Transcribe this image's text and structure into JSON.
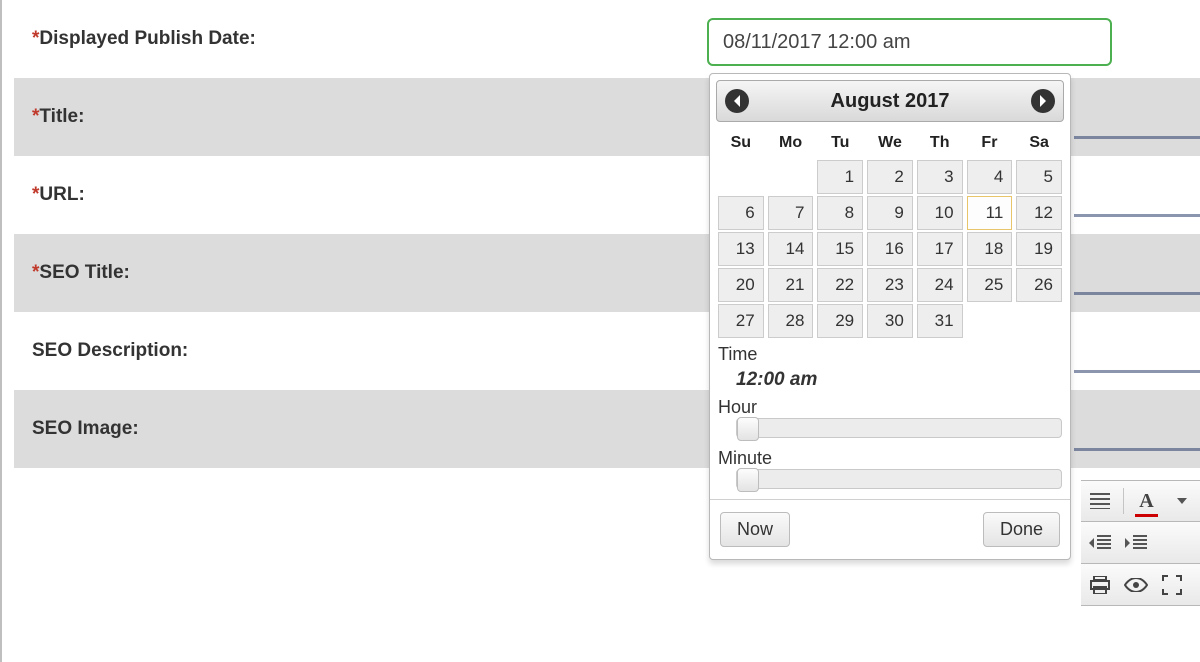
{
  "form": {
    "displayed_publish_date_label": "Displayed Publish Date:",
    "title_label": "Title:",
    "url_label": "URL:",
    "seo_title_label": "SEO Title:",
    "seo_description_label": "SEO Description:",
    "seo_image_label": "SEO Image:",
    "publish_date_value": "08/11/2017 12:00 am"
  },
  "datepicker": {
    "title": "August 2017",
    "day_headers": [
      "Su",
      "Mo",
      "Tu",
      "We",
      "Th",
      "Fr",
      "Sa"
    ],
    "selected_day": 11,
    "weeks": [
      [
        null,
        null,
        1,
        2,
        3,
        4,
        5
      ],
      [
        6,
        7,
        8,
        9,
        10,
        11,
        12
      ],
      [
        13,
        14,
        15,
        16,
        17,
        18,
        19
      ],
      [
        20,
        21,
        22,
        23,
        24,
        25,
        26
      ],
      [
        27,
        28,
        29,
        30,
        31,
        null,
        null
      ]
    ],
    "time_label": "Time",
    "time_value": "12:00 am",
    "hour_label": "Hour",
    "minute_label": "Minute",
    "now_label": "Now",
    "done_label": "Done"
  },
  "toolbar": {
    "rows_present": 3
  }
}
